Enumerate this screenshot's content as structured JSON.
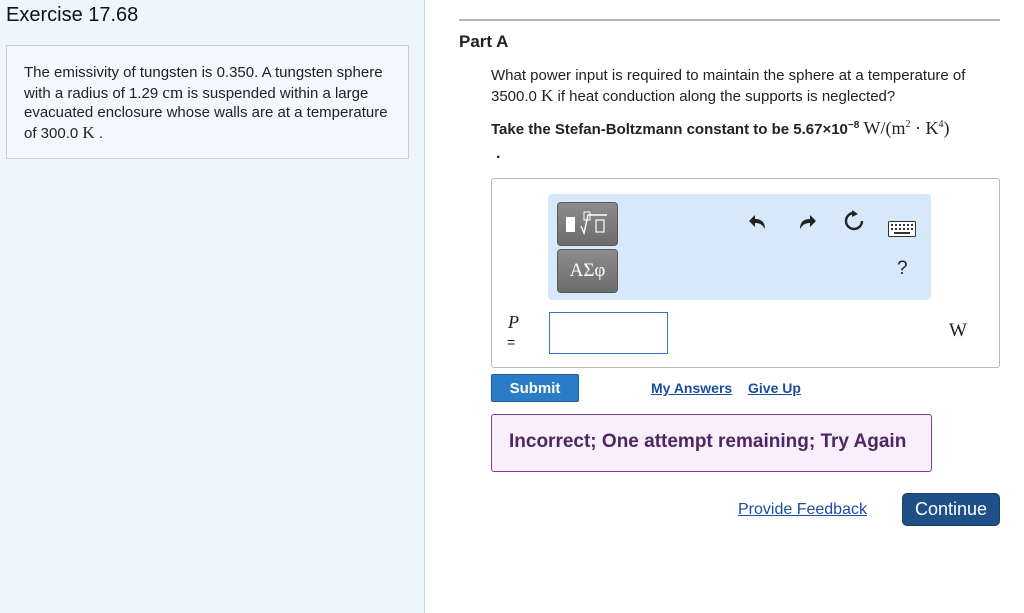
{
  "exercise": {
    "title": "Exercise 17.68"
  },
  "problem": {
    "text_1": "The emissivity of tungsten is 0.350. A tungsten sphere with a radius of 1.29 ",
    "unit_cm": "cm",
    "text_2": " is suspended within a large evacuated enclosure whose walls are at a temperature of 300.0 ",
    "unit_k": "K",
    "text_3": " ."
  },
  "part": {
    "title": "Part A",
    "question_1": "What power input is required to maintain the sphere at a temperature of 3500.0 ",
    "question_unit": "K",
    "question_2": " if heat conduction along the supports is neglected?",
    "constant_text": "Take the Stefan-Boltzmann constant to be 5.67×10",
    "constant_exp": "−8",
    "constant_unit_a": " W/(m",
    "constant_unit_sq": "2",
    "constant_unit_b": " · K",
    "constant_unit_4": "4",
    "constant_unit_c": ")",
    "trailing_dot": "."
  },
  "toolbar": {
    "template_button": "■√□",
    "greek_button": "ΑΣφ",
    "undo_icon": "undo-icon",
    "redo_icon": "redo-icon",
    "reset_icon": "reset-icon",
    "keyboard_icon": "keyboard-icon",
    "help_label": "?"
  },
  "answer": {
    "variable": "P",
    "equals": "=",
    "value": "",
    "unit": "W"
  },
  "actions": {
    "submit": "Submit",
    "my_answers": "My Answers",
    "give_up": "Give Up",
    "provide_feedback": "Provide Feedback",
    "continue": "Continue"
  },
  "feedback": {
    "message": "Incorrect; One attempt remaining; Try Again"
  },
  "colors": {
    "left_pane_bg": "#eef6fd",
    "toolbar_bg": "#d7e8fb",
    "submit_bg": "#2b7cc6",
    "feedback_bg": "#f8eefc",
    "feedback_border": "#7d3f94",
    "continue_bg": "#1e4f87",
    "link": "#1b4da2"
  }
}
